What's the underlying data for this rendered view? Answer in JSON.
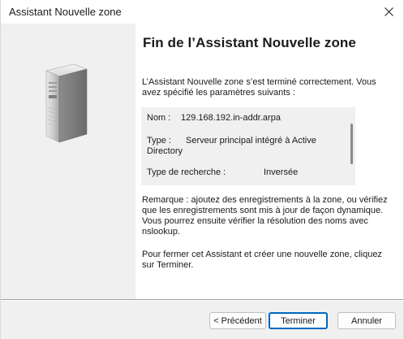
{
  "window": {
    "title": "Assistant Nouvelle zone",
    "close_icon": "close-icon"
  },
  "left_panel": {
    "illustration": "server-icon"
  },
  "content": {
    "heading": "Fin de l’Assistant Nouvelle zone",
    "intro": "L’Assistant Nouvelle zone s’est terminé correctement. Vous avez spécifié les paramètres suivants :",
    "summary": {
      "name_label": "Nom :",
      "name_value": "129.168.192.in-addr.arpa",
      "type_label": "Type :",
      "type_value_line1": "Serveur principal intégré à Active",
      "type_value_line2": "Directory",
      "lookup_label": "Type de recherche :",
      "lookup_value": "Inversée"
    },
    "remark": "Remarque : ajoutez des enregistrements à la zone, ou vérifiez que les enregistrements sont mis à jour de façon dynamique. Vous pourrez ensuite vérifier la résolution des noms avec nslookup.",
    "closing": "Pour fermer cet Assistant et créer une nouvelle zone, cliquez sur Terminer."
  },
  "buttons": {
    "back": "< Précédent",
    "finish": "Terminer",
    "cancel": "Annuler"
  },
  "colors": {
    "accent": "#0067c0",
    "dialog_bg": "#f0f0f0"
  }
}
